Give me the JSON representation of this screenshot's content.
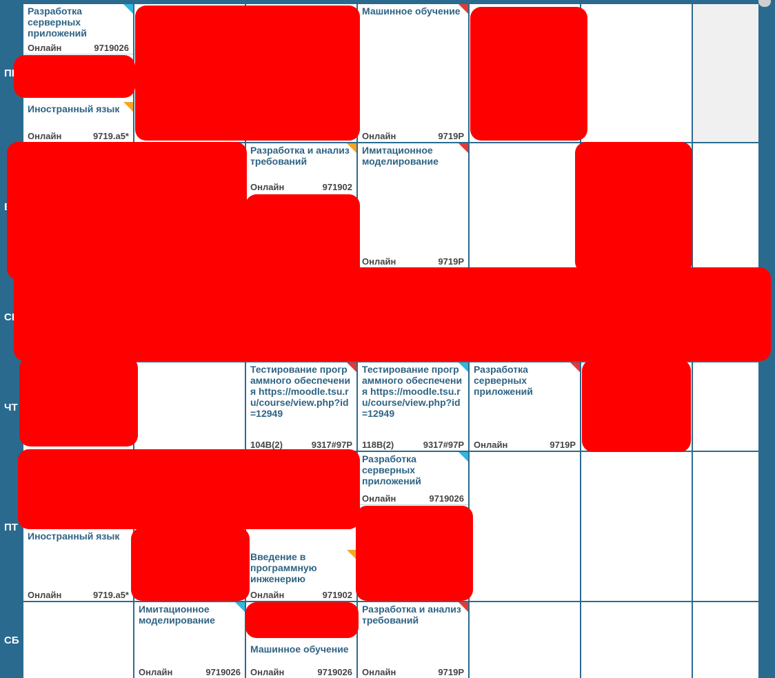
{
  "days": [
    "ПН",
    "ВТ",
    "СР",
    "ЧТ",
    "ПТ",
    "СБ"
  ],
  "lessons": [
    {
      "title": "Разработка серверных приложений",
      "room": "Онлайн",
      "group": "9719026"
    },
    {
      "title": "Иностранный язык",
      "room": "Онлайн",
      "group": "9719.а5*"
    },
    {
      "title": "Машинное обучение",
      "room": "Онлайн",
      "group": "9719Р"
    },
    {
      "title": "Разработка и анализ требований",
      "room": "Онлайн",
      "group": "971902"
    },
    {
      "title": "Имитационное моделирование",
      "room": "Онлайн",
      "group": "9719Р"
    },
    {
      "title": "Тестирование программного обеспечения https://moodle.tsu.ru/course/view.php?id=12949",
      "room": "104В(2)",
      "group": "9317#97Р"
    },
    {
      "title": "Тестирование программного обеспечения https://moodle.tsu.ru/course/view.php?id=12949",
      "room": "118В(2)",
      "group": "9317#97Р"
    },
    {
      "title": "Разработка серверных приложений",
      "room": "Онлайн",
      "group": "9719Р"
    },
    {
      "title": "Разработка серверных приложений",
      "room": "Онлайн",
      "group": "9719026"
    },
    {
      "title": "Иностранный язык",
      "room": "Онлайн",
      "group": "9719.а5*"
    },
    {
      "title": "Введение в программную инженерию",
      "room": "Онлайн",
      "group": "971902"
    },
    {
      "title": "Имитационное моделирование",
      "room": "Онлайн",
      "group": "9719026"
    },
    {
      "title": "Машинное обучение",
      "room": "Онлайн",
      "group": "9719026"
    },
    {
      "title": "Разработка и анализ требований",
      "room": "Онлайн",
      "group": "9719Р"
    }
  ],
  "colors": {
    "header_blue": "#2a6a8f",
    "title_text": "#2e6384",
    "tag_blue": "#35b6df",
    "tag_orange": "#f5a623",
    "tag_red": "#e53935",
    "redaction": "#ff0000"
  }
}
